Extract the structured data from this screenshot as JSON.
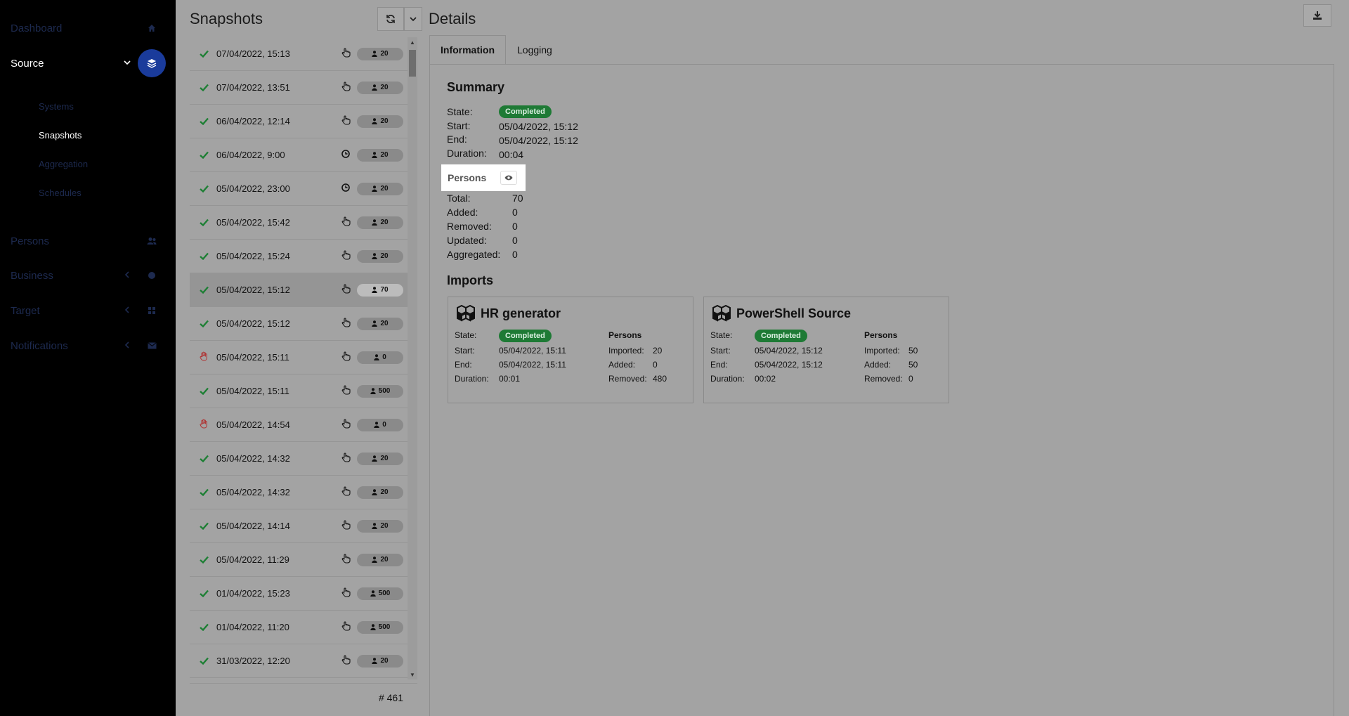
{
  "sidebar": {
    "items": [
      {
        "label": "Dashboard",
        "icon": "home-icon"
      },
      {
        "label": "Source",
        "icon": "layers-icon",
        "active": true
      },
      {
        "label": "Persons",
        "icon": "users-icon"
      },
      {
        "label": "Business",
        "icon": "business-icon"
      },
      {
        "label": "Target",
        "icon": "grid-icon"
      },
      {
        "label": "Notifications",
        "icon": "envelope-icon"
      }
    ],
    "sub_items": [
      {
        "label": "Systems"
      },
      {
        "label": "Snapshots",
        "active": true
      },
      {
        "label": "Aggregation"
      },
      {
        "label": "Schedules"
      }
    ]
  },
  "snapshots": {
    "title": "Snapshots",
    "total_label": "# 461",
    "rows": [
      {
        "date": "07/04/2022, 15:13",
        "status": "ok",
        "trigger": "manual",
        "count": "20"
      },
      {
        "date": "07/04/2022, 13:51",
        "status": "ok",
        "trigger": "manual",
        "count": "20"
      },
      {
        "date": "06/04/2022, 12:14",
        "status": "ok",
        "trigger": "manual",
        "count": "20"
      },
      {
        "date": "06/04/2022, 9:00",
        "status": "ok",
        "trigger": "scheduled",
        "count": "20"
      },
      {
        "date": "05/04/2022, 23:00",
        "status": "ok",
        "trigger": "scheduled",
        "count": "20"
      },
      {
        "date": "05/04/2022, 15:42",
        "status": "ok",
        "trigger": "manual",
        "count": "20"
      },
      {
        "date": "05/04/2022, 15:24",
        "status": "ok",
        "trigger": "manual",
        "count": "20"
      },
      {
        "date": "05/04/2022, 15:12",
        "status": "ok",
        "trigger": "manual",
        "count": "70",
        "selected": true
      },
      {
        "date": "05/04/2022, 15:12",
        "status": "ok",
        "trigger": "manual",
        "count": "20"
      },
      {
        "date": "05/04/2022, 15:11",
        "status": "error",
        "trigger": "manual",
        "count": "0"
      },
      {
        "date": "05/04/2022, 15:11",
        "status": "ok",
        "trigger": "manual",
        "count": "500"
      },
      {
        "date": "05/04/2022, 14:54",
        "status": "error",
        "trigger": "manual",
        "count": "0"
      },
      {
        "date": "05/04/2022, 14:32",
        "status": "ok",
        "trigger": "manual",
        "count": "20"
      },
      {
        "date": "05/04/2022, 14:32",
        "status": "ok",
        "trigger": "manual",
        "count": "20"
      },
      {
        "date": "05/04/2022, 14:14",
        "status": "ok",
        "trigger": "manual",
        "count": "20"
      },
      {
        "date": "05/04/2022, 11:29",
        "status": "ok",
        "trigger": "manual",
        "count": "20"
      },
      {
        "date": "01/04/2022, 15:23",
        "status": "ok",
        "trigger": "manual",
        "count": "500"
      },
      {
        "date": "01/04/2022, 11:20",
        "status": "ok",
        "trigger": "manual",
        "count": "500"
      },
      {
        "date": "31/03/2022, 12:20",
        "status": "ok",
        "trigger": "manual",
        "count": "20"
      }
    ]
  },
  "details": {
    "title": "Details",
    "tabs": [
      {
        "label": "Information"
      },
      {
        "label": "Logging"
      }
    ],
    "summary": {
      "heading": "Summary",
      "state_label": "State:",
      "state": "Completed",
      "start_label": "Start:",
      "start": "05/04/2022, 15:12",
      "end_label": "End:",
      "end": "05/04/2022, 15:12",
      "duration_label": "Duration:",
      "duration": "00:04"
    },
    "persons": {
      "heading": "Persons",
      "total_label": "Total:",
      "total": "70",
      "added_label": "Added:",
      "added": "0",
      "removed_label": "Removed:",
      "removed": "0",
      "updated_label": "Updated:",
      "updated": "0",
      "aggregated_label": "Aggregated:",
      "aggregated": "0"
    },
    "imports": {
      "heading": "Imports",
      "cards": [
        {
          "name": "HR generator",
          "state_label": "State:",
          "state": "Completed",
          "start_label": "Start:",
          "start": "05/04/2022, 15:11",
          "end_label": "End:",
          "end": "05/04/2022, 15:11",
          "duration_label": "Duration:",
          "duration": "00:01",
          "persons_heading": "Persons",
          "imported_label": "Imported:",
          "imported": "20",
          "added_label": "Added:",
          "added": "0",
          "removed_label": "Removed:",
          "removed": "480"
        },
        {
          "name": "PowerShell Source",
          "state_label": "State:",
          "state": "Completed",
          "start_label": "Start:",
          "start": "05/04/2022, 15:12",
          "end_label": "End:",
          "end": "05/04/2022, 15:12",
          "duration_label": "Duration:",
          "duration": "00:02",
          "persons_heading": "Persons",
          "imported_label": "Imported:",
          "imported": "50",
          "added_label": "Added:",
          "added": "50",
          "removed_label": "Removed:",
          "removed": "0"
        }
      ]
    }
  }
}
